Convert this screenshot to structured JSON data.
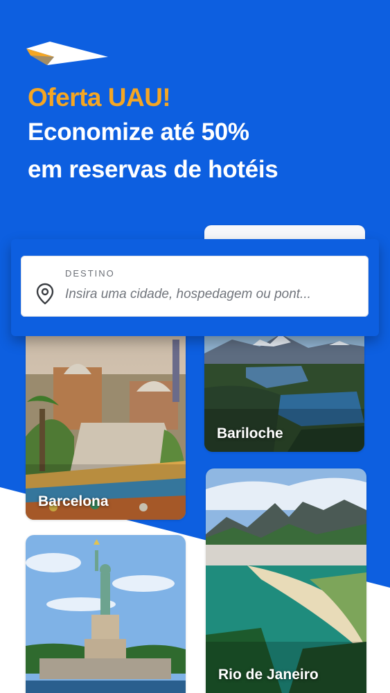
{
  "promo": {
    "kicker": "Oferta UAU!",
    "line1": "Economize até 50%",
    "line2": "em reservas de hotéis"
  },
  "search": {
    "label": "DESTINO",
    "placeholder": "Insira uma cidade, hospedagem ou pont...",
    "icon": "location-pin-icon"
  },
  "destinations": [
    {
      "name": "Barcelona"
    },
    {
      "name": "Bariloche"
    },
    {
      "name": "Rio de Janeiro"
    },
    {
      "name": ""
    }
  ],
  "colors": {
    "brand_blue": "#0d5fe0",
    "accent_orange": "#f5a623",
    "text_white": "#ffffff"
  }
}
